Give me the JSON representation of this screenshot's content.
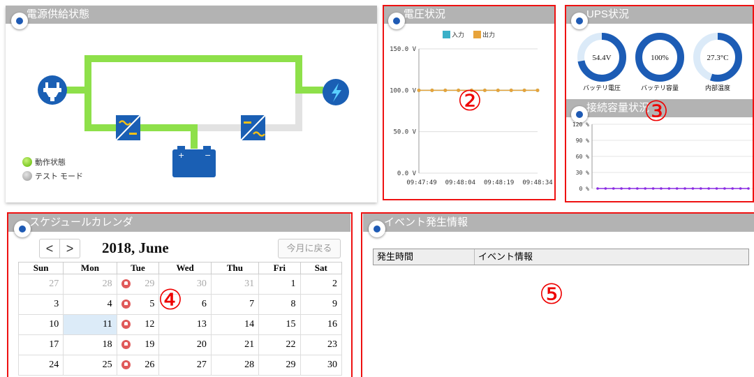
{
  "power": {
    "title": "電源供給状態",
    "legend": [
      {
        "label": "動作状態",
        "color": "#5cb800"
      },
      {
        "label": "テスト モード",
        "color": "#999999"
      }
    ]
  },
  "voltage": {
    "title": "電圧状況",
    "callout": "②"
  },
  "ups": {
    "title": "UPS状況",
    "gauges": [
      {
        "value": "54.4V",
        "label": "バッテリ電圧",
        "fraction": 0.72
      },
      {
        "value": "100%",
        "label": "バッテリ容量",
        "fraction": 1.0
      },
      {
        "value": "27.3°C",
        "label": "内部温度",
        "fraction": 0.55
      }
    ],
    "callout": "③"
  },
  "connection": {
    "title": "接続容量状況",
    "y_ticks": [
      "120 %",
      "90 %",
      "60 %",
      "30 %",
      "0 %"
    ]
  },
  "schedule": {
    "title": "スケジュールカレンダ",
    "prev": "<",
    "next": ">",
    "month_label": "2018, June",
    "today_button": "今月に戻る",
    "weekdays": [
      "Sun",
      "Mon",
      "Tue",
      "Wed",
      "Thu",
      "Fri",
      "Sat"
    ],
    "weeks": [
      [
        {
          "d": "27",
          "other": true
        },
        {
          "d": "28",
          "other": true
        },
        {
          "d": "29",
          "other": true,
          "bell": true
        },
        {
          "d": "30",
          "other": true
        },
        {
          "d": "31",
          "other": true
        },
        {
          "d": "1"
        },
        {
          "d": "2"
        }
      ],
      [
        {
          "d": "3"
        },
        {
          "d": "4"
        },
        {
          "d": "5",
          "bell": true
        },
        {
          "d": "6"
        },
        {
          "d": "7"
        },
        {
          "d": "8"
        },
        {
          "d": "9"
        }
      ],
      [
        {
          "d": "10"
        },
        {
          "d": "11",
          "today": true
        },
        {
          "d": "12",
          "bell": true
        },
        {
          "d": "13"
        },
        {
          "d": "14"
        },
        {
          "d": "15"
        },
        {
          "d": "16"
        }
      ],
      [
        {
          "d": "17"
        },
        {
          "d": "18"
        },
        {
          "d": "19",
          "bell": true
        },
        {
          "d": "20"
        },
        {
          "d": "21"
        },
        {
          "d": "22"
        },
        {
          "d": "23"
        }
      ],
      [
        {
          "d": "24"
        },
        {
          "d": "25"
        },
        {
          "d": "26",
          "bell": true
        },
        {
          "d": "27"
        },
        {
          "d": "28"
        },
        {
          "d": "29"
        },
        {
          "d": "30"
        }
      ]
    ],
    "callout": "④"
  },
  "events": {
    "title": "イベント発生情報",
    "columns": [
      "発生時間",
      "イベント情報"
    ],
    "callout": "⑤"
  },
  "chart_data": [
    {
      "type": "line",
      "title": "",
      "legend": [
        "入力",
        "出力"
      ],
      "legend_placement": "top",
      "x": [
        "09:47:49",
        "09:48:04",
        "09:48:19",
        "09:48:34"
      ],
      "y_ticks": [
        "150.0 V",
        "100.0 V",
        "50.0 V",
        "0.0 V"
      ],
      "ylim": [
        0,
        150
      ],
      "grid": true,
      "series": [
        {
          "name": "入力",
          "color": "#3ab0c8",
          "values": [
            100,
            100,
            100,
            100,
            100,
            100,
            100,
            100,
            100,
            100
          ]
        },
        {
          "name": "出力",
          "color": "#e7a33a",
          "values": [
            100,
            100,
            100,
            100,
            100,
            100,
            100,
            100,
            100,
            100
          ]
        }
      ]
    },
    {
      "type": "line",
      "title": "",
      "ylim": [
        0,
        120
      ],
      "y_ticks": [
        "120 %",
        "90 %",
        "60 %",
        "30 %",
        "0 %"
      ],
      "grid": true,
      "series": [
        {
          "color": "#8a2be2",
          "values": [
            0,
            0,
            0,
            0,
            0,
            0,
            0,
            0,
            0,
            0,
            0,
            0,
            0,
            0,
            0,
            0,
            0,
            0,
            0,
            0
          ]
        }
      ]
    }
  ]
}
